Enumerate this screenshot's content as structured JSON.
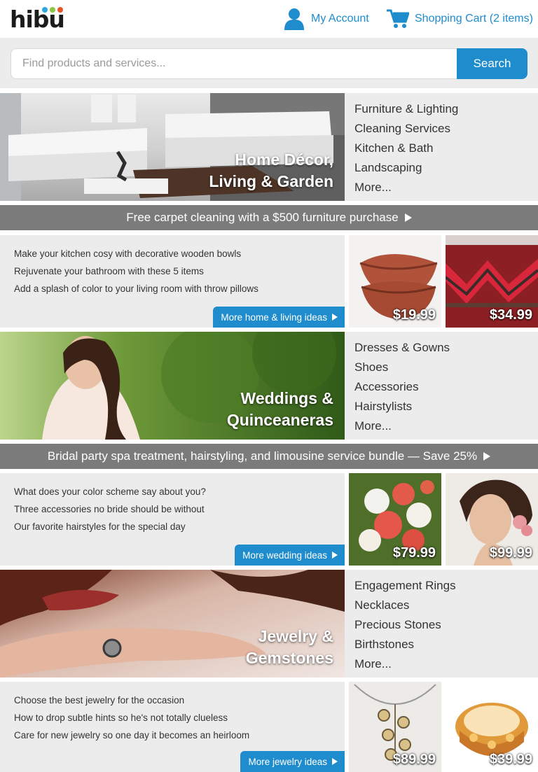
{
  "header": {
    "logo": "hibu",
    "logo_dot_colors": [
      "#2aa7df",
      "#8cc63f",
      "#e8542a"
    ],
    "account_label": "My Account",
    "cart_label": "Shopping Cart (2 items)",
    "accent_color": "#1e8ccd"
  },
  "search": {
    "placeholder": "Find products and services...",
    "button_label": "Search"
  },
  "sections": [
    {
      "title_line1": "Home Décor,",
      "title_line2": "Living & Garden",
      "categories": [
        "Furniture & Lighting",
        "Cleaning Services",
        "Kitchen & Bath",
        "Landscaping",
        "More..."
      ],
      "promo": "Free carpet cleaning with a $500 furniture purchase",
      "ideas": [
        "Make your kitchen cosy with decorative wooden bowls",
        "Rejuvenate your bathroom with these 5 items",
        "Add a splash of color to your living room with throw pillows"
      ],
      "more_label": "More home & living ideas",
      "products": [
        {
          "price": "$19.99",
          "icon": "wooden-bowls-image"
        },
        {
          "price": "$34.99",
          "icon": "kilim-ottoman-image"
        }
      ]
    },
    {
      "title_line1": "Weddings &",
      "title_line2": "Quinceaneras",
      "categories": [
        "Dresses & Gowns",
        "Shoes",
        "Accessories",
        "Hairstylists",
        "More..."
      ],
      "promo": "Bridal party spa treatment, hairstyling, and limousine service bundle — Save 25%",
      "ideas": [
        "What does your color scheme say about you?",
        "Three accessories no bride should be without",
        "Our favorite hairstyles for the special day"
      ],
      "more_label": "More wedding ideas",
      "products": [
        {
          "price": "$79.99",
          "icon": "bridal-bouquet-image"
        },
        {
          "price": "$99.99",
          "icon": "bridal-hairstyle-image"
        }
      ]
    },
    {
      "title_line1": "Jewelry &",
      "title_line2": "Gemstones",
      "categories": [
        "Engagement Rings",
        "Necklaces",
        "Precious Stones",
        "Birthstones",
        "More..."
      ],
      "ideas": [
        "Choose the best jewelry for the occasion",
        "How to drop subtle hints so he's not totally clueless",
        "Care for new jewelry so one day it becomes an heirloom"
      ],
      "more_label": "More jewelry ideas",
      "products": [
        {
          "price": "$89.99",
          "icon": "pendant-necklace-image"
        },
        {
          "price": "$39.99",
          "icon": "gold-cuff-bracelet-image"
        }
      ]
    }
  ]
}
